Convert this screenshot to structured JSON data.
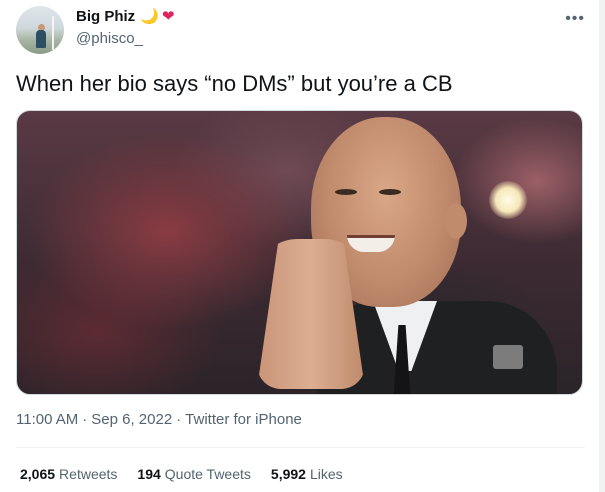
{
  "tweet": {
    "author": {
      "display_name": "Big Phiz",
      "emoji_moon": "🌙",
      "emoji_heart": "❤",
      "handle": "@phisco_"
    },
    "more_icon": "more-horizontal-icon",
    "text": "When her bio says “no DMs” but you’re a CB",
    "meta": {
      "time": "11:00 AM",
      "date": "Sep 6, 2022",
      "source": "Twitter for iPhone"
    },
    "stats": {
      "retweets_count": "2,065",
      "retweets_label": "Retweets",
      "quote_count": "194",
      "quote_label": "Quote Tweets",
      "likes_count": "5,992",
      "likes_label": "Likes"
    }
  },
  "colors": {
    "text_primary": "#0f1419",
    "text_secondary": "#536471",
    "heart": "#e0245e",
    "moon": "#f5c518",
    "divider": "#eff3f4"
  }
}
